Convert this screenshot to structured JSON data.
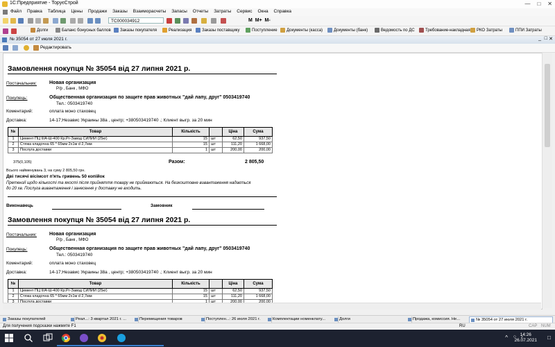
{
  "window": {
    "title": "1С:Предприятие - ТоруєСтрой"
  },
  "menu": [
    "Файл",
    "Правка",
    "Таблица",
    "Цены",
    "Продажи",
    "Заказы",
    "Взаиморасчеты",
    "Запасы",
    "Отчеты",
    "Затраты",
    "Сервис",
    "Окна",
    "Справка"
  ],
  "toolbar": {
    "doc_number": "ТС000034912",
    "extras": [
      "M",
      "M+",
      "M-"
    ]
  },
  "quick_links": [
    "Долги",
    "Баланс бонусных баллов",
    "Заказы покупателя",
    "Реализация",
    "Заказы поставщику",
    "Поступление",
    "Документы (касса)",
    "Документы (банк)",
    "Ведомость по ДС",
    "Требование-накладная",
    "РКО Затраты",
    "ППИ Затраты"
  ],
  "doc_window": {
    "title": "№ 35054 от 27 июля 2021 г.",
    "edit_label": "Редактировать"
  },
  "invoice": {
    "title": "Замовлення покупця № 35054 від 27 липня 2021 р.",
    "supplier_label": "Постачальник:",
    "supplier_name": "Новая организация",
    "supplier_details": "Р/р , Банк , МФО",
    "buyer_label": "Покупець:",
    "buyer_name": "Общественная организация по защите прав животных \"дай лапу, друг\" 0503419740",
    "buyer_phone": "Тел.: 0503419740",
    "comment_label": "Коментарий:",
    "comment_value": "оплата моно стаховец",
    "delivery_label": "Доставка:",
    "delivery_value": "14-17;Независ Украины 38а , центр;  +380503419740 .; Клиент выгр. за 20 мин",
    "columns": [
      "№",
      "Товар",
      "Кількість",
      "",
      "Ціна",
      "Сума"
    ],
    "rows": [
      {
        "n": "1",
        "name": "Цемент ПЦ ІІ/А-Ш-400 Кр.Рг-Завод СИЛИЙ (25кг)",
        "qty": "15",
        "unit": "шт",
        "price": "62,50",
        "sum": "937,50"
      },
      {
        "n": "2",
        "name": "Стяжа кладочна 65 * 65мм 2х1м d 2,7мм",
        "qty": "15",
        "unit": "шт",
        "price": "111,20",
        "sum": "1 668,00"
      },
      {
        "n": "3",
        "name": "Послуга доставки",
        "qty": "1",
        "unit": "шт",
        "price": "200,00",
        "sum": "200,00"
      }
    ],
    "code": "375(0,105)",
    "total_label": "Разом:",
    "total_value": "2 805,50",
    "items_summary": "Всього найменувань 3, на суму 2 805,50 грн.",
    "total_words": "Дві тисячі вісімсот п'ять гривень 50 копійок",
    "disclaimer": "Претензії щодо кількості та якості після прийняття товару не приймаються. На безкоштовне вивантаження надається до 20 хв. Послуга вивантаження і занесення у доставку не входить.",
    "executor_label": "Виконавець",
    "customer_label": "Замовник"
  },
  "window_tabs": [
    "Заказы покупателей",
    "Реал...: 3 квартал 2021 г. ...",
    "Перемещения товаров",
    "Поступлен...: 26 июля 2021 г.",
    "Комплектации номенклату...",
    "Долги",
    "Продажа, комиссия. Не...",
    "№ 35054 от 27 июля 2021 г."
  ],
  "status": {
    "hint": "Для получения подсказки нажмите F1",
    "lang": "RU",
    "cap": "CAP",
    "num": "NUM"
  },
  "taskbar": {
    "time": "14:26",
    "date": "26.07.2021"
  }
}
